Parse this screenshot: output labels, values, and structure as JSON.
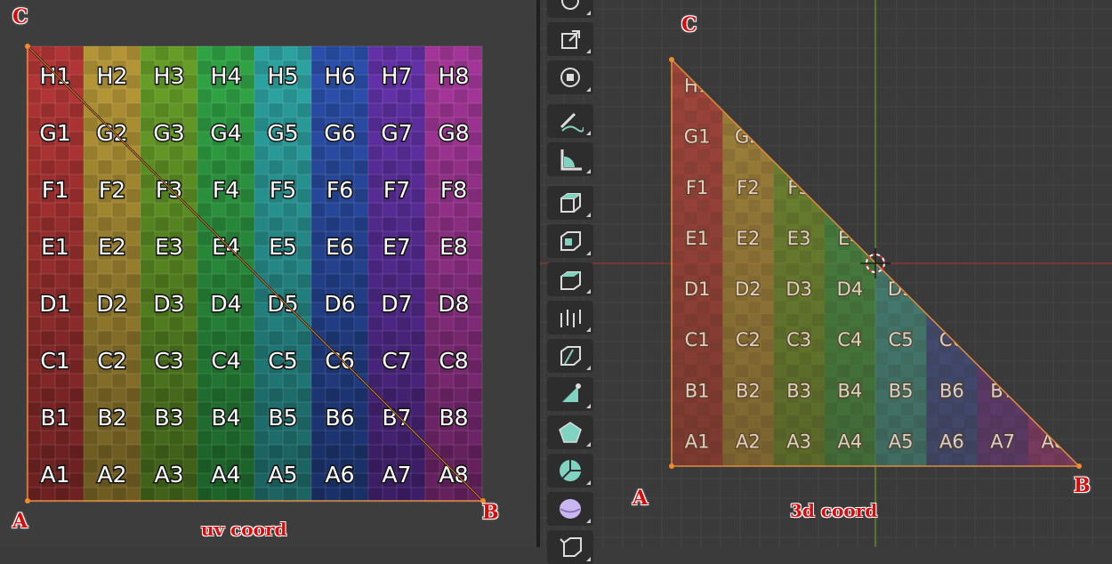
{
  "uv_editor": {
    "caption": "uv coord",
    "vertices": {
      "a": "A",
      "b": "B",
      "c": "C"
    }
  },
  "viewport_3d": {
    "caption": "3d coord",
    "vertices": {
      "a": "A",
      "b": "B",
      "c": "C"
    }
  },
  "texture": {
    "rows": [
      "H",
      "G",
      "F",
      "E",
      "D",
      "C",
      "B",
      "A"
    ],
    "columns": [
      "1",
      "2",
      "3",
      "4",
      "5",
      "6",
      "7",
      "8"
    ],
    "column_colors": [
      "#c23a3a",
      "#c3a23a",
      "#6fab2a",
      "#33b04a",
      "#2fb0ae",
      "#2e55b8",
      "#6a35b5",
      "#b13aa5"
    ]
  },
  "toolbar": {
    "tools": [
      {
        "name": "rotate-tool",
        "icon": "rotate-icon"
      },
      {
        "name": "scale-tool",
        "icon": "scale-icon"
      },
      {
        "name": "transform-tool",
        "icon": "transform-icon"
      },
      {
        "name": "annotate-tool",
        "icon": "annotate-pencil-icon"
      },
      {
        "name": "measure-tool",
        "icon": "measure-ruler-icon"
      },
      {
        "name": "add-cube-tool",
        "icon": "add-cube-icon"
      },
      {
        "name": "extrude-region-tool",
        "icon": "extrude-icon"
      },
      {
        "name": "inset-faces-tool",
        "icon": "inset-icon"
      },
      {
        "name": "bevel-tool",
        "icon": "bevel-icon"
      },
      {
        "name": "loop-cut-tool",
        "icon": "loop-cut-icon"
      },
      {
        "name": "knife-tool",
        "icon": "knife-icon"
      },
      {
        "name": "poly-build-tool",
        "icon": "poly-build-icon"
      },
      {
        "name": "spin-tool",
        "icon": "spin-icon"
      },
      {
        "name": "smooth-tool",
        "icon": "smooth-icon"
      },
      {
        "name": "shear-tool",
        "icon": "shear-icon"
      },
      {
        "name": "rip-region-tool",
        "icon": "rip-icon"
      }
    ],
    "accent": "#7fd3c0"
  }
}
